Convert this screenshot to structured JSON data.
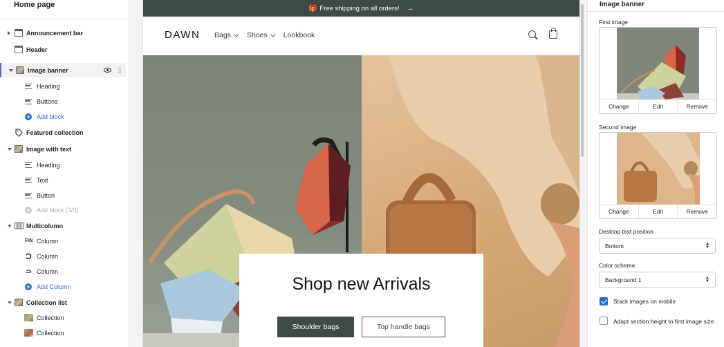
{
  "sidebar": {
    "title": "Home page",
    "rows": [
      {
        "kind": "section",
        "label": "Announcement bar"
      },
      {
        "kind": "section",
        "label": "Header"
      },
      {
        "kind": "section",
        "label": "Image banner"
      },
      {
        "kind": "block",
        "label": "Heading"
      },
      {
        "kind": "block",
        "label": "Buttons"
      },
      {
        "kind": "add",
        "label": "Add block"
      },
      {
        "kind": "section",
        "label": "Featured collection"
      },
      {
        "kind": "section",
        "label": "Image with text"
      },
      {
        "kind": "block",
        "label": "Heading"
      },
      {
        "kind": "block",
        "label": "Text"
      },
      {
        "kind": "block",
        "label": "Button"
      },
      {
        "kind": "add-disabled",
        "label": "Add block (3/3)"
      },
      {
        "kind": "section",
        "label": "Multicolumn"
      },
      {
        "kind": "block",
        "label": "Column",
        "glyph": "FIN"
      },
      {
        "kind": "block",
        "label": "Column",
        "glyph": "Ɔ"
      },
      {
        "kind": "block",
        "label": "Column",
        "glyph": "⸧"
      },
      {
        "kind": "add",
        "label": "Add Column"
      },
      {
        "kind": "section",
        "label": "Collection list"
      },
      {
        "kind": "block",
        "label": "Collection"
      },
      {
        "kind": "block",
        "label": "Collection"
      }
    ]
  },
  "preview": {
    "announcement": "Free shipping on all orders!",
    "announcement_emoji": "🎁",
    "announcement_arrow": "→",
    "logo": "DAWN",
    "nav": [
      "Bags",
      "Shoes",
      "Lookbook"
    ],
    "banner_heading": "Shop new Arrivals",
    "button_primary": "Shoulder bags",
    "button_secondary": "Top handle bags"
  },
  "panel": {
    "title": "Image banner",
    "first_image_label": "First image",
    "second_image_label": "Second image",
    "image_actions": [
      "Change",
      "Edit",
      "Remove"
    ],
    "desktop_text_position_label": "Desktop text position",
    "desktop_text_position_value": "Bottom",
    "color_scheme_label": "Color scheme",
    "color_scheme_value": "Background 1",
    "stack_images_label": "Stack images on mobile",
    "stack_images_checked": true,
    "adapt_height_label": "Adapt section height to first image size",
    "adapt_height_checked": false
  },
  "colors": {
    "accent": "#2c6ecb",
    "brand_dark": "#3d4a46",
    "active_indicator": "#5c6ac4"
  }
}
